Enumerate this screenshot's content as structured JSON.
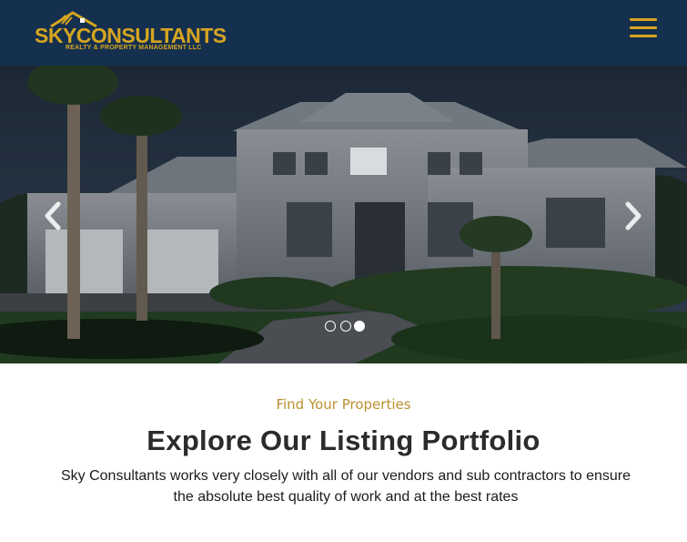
{
  "header": {
    "logo": {
      "brand_name": "SKYCONSULTANTS",
      "tagline": "REALTY & PROPERTY MANAGEMENT LLC"
    },
    "menu_icon": "hamburger-menu-icon"
  },
  "hero": {
    "prev_icon": "chevron-left-icon",
    "next_icon": "chevron-right-icon",
    "slides_count": 3,
    "active_slide": 3
  },
  "section": {
    "kicker": "Find Your Properties",
    "title": "Explore Our Listing Portfolio",
    "body": "Sky Consultants works very closely with all of our vendors and sub contractors to ensure the absolute best quality of work and at the best rates"
  },
  "colors": {
    "header_bg": "#15304e",
    "brand_gold": "#d6a521",
    "kicker_gold": "#b9912f",
    "title_text": "#2b2b2b"
  }
}
